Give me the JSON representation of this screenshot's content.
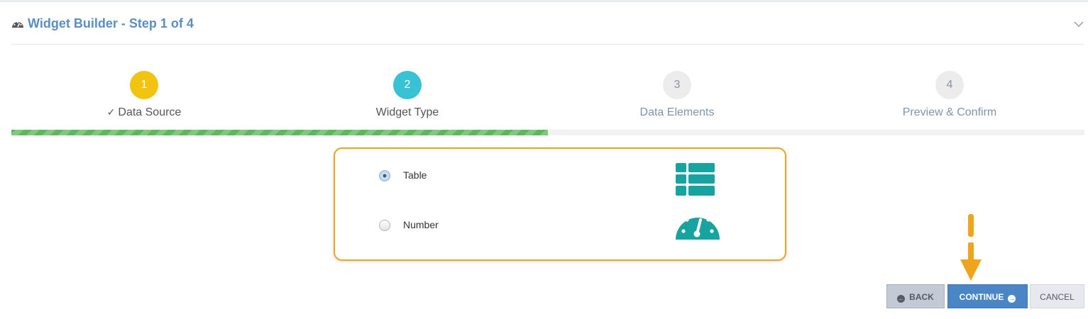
{
  "header": {
    "title": "Widget Builder - Step 1 of 4",
    "icon": "dashboard-icon",
    "collapse_icon": "chevron-down-icon"
  },
  "steps": [
    {
      "number": "1",
      "label": "Data Source",
      "status": "completed",
      "color": "#f2c40f"
    },
    {
      "number": "2",
      "label": "Widget Type",
      "status": "active",
      "color": "#39c1d4"
    },
    {
      "number": "3",
      "label": "Data Elements",
      "status": "pending",
      "color": "#ececec"
    },
    {
      "number": "4",
      "label": "Preview & Confirm",
      "status": "pending",
      "color": "#ececec"
    }
  ],
  "progress": {
    "fraction": 0.5,
    "color": "#5cb85c"
  },
  "widget_options": [
    {
      "label": "Table",
      "selected": true,
      "icon": "table-icon"
    },
    {
      "label": "Number",
      "selected": false,
      "icon": "gauge-icon"
    }
  ],
  "colors": {
    "accent": "#4a86c5",
    "highlight_border": "#f0a31d",
    "icon_teal": "#17a3a0",
    "annotation_arrow": "#f0a31d"
  },
  "buttons": {
    "back": "BACK",
    "continue": "CONTINUE",
    "cancel": "CANCEL"
  }
}
